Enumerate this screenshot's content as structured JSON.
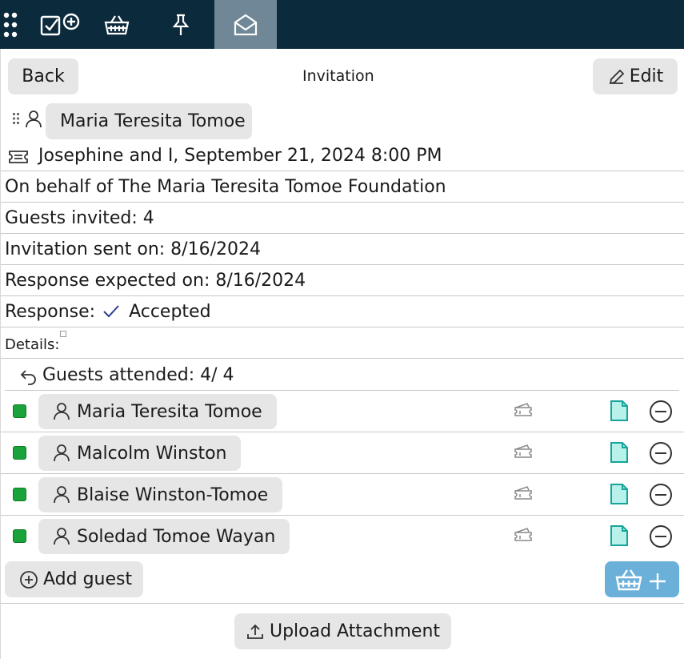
{
  "topbar": {
    "icons": [
      "grid-icon",
      "checklist-add-icon",
      "basket-icon",
      "pin-icon",
      "envelope-open-icon"
    ],
    "active": "envelope-open-icon"
  },
  "header": {
    "back_label": "Back",
    "title": "Invitation",
    "edit_label": "Edit"
  },
  "host": {
    "name": "Maria Teresita Tomoe"
  },
  "event": {
    "text": "Josephine and I, September 21, 2024 8:00 PM"
  },
  "fields": {
    "on_behalf": "On behalf of The Maria Teresita Tomoe Foundation",
    "guests_invited": "Guests invited: 4",
    "invitation_sent": "Invitation sent on: 8/16/2024",
    "response_expected": "Response expected on: 8/16/2024",
    "response_label": "Response:",
    "response_value": "Accepted",
    "details_label": "Details:"
  },
  "attended": {
    "label": "Guests attended: 4/ 4"
  },
  "guests": [
    {
      "name": "Maria Teresita Tomoe",
      "checked": true
    },
    {
      "name": "Malcolm Winston",
      "checked": true
    },
    {
      "name": "Blaise Winston-Tomoe",
      "checked": true
    },
    {
      "name": "Soledad Tomoe Wayan",
      "checked": true
    }
  ],
  "actions": {
    "add_guest_label": "Add guest",
    "upload_label": "Upload Attachment"
  },
  "colors": {
    "topbar": "#0b2a3c",
    "active_tab": "#6f8796",
    "checkbox": "#1aa33a",
    "basket_button": "#6ab0d8",
    "doc_icon": "#16a59a"
  }
}
